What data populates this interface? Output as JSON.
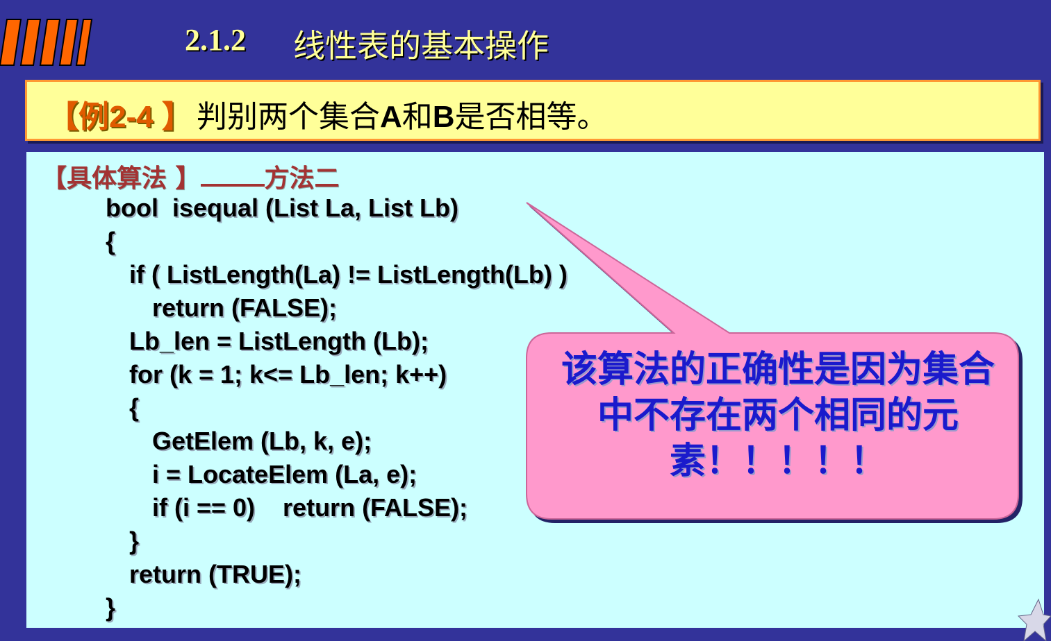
{
  "header": {
    "section_number": "2.1.2",
    "section_title": "线性表的基本操作"
  },
  "example": {
    "tag": "【例2-4 】",
    "text_part1": "判别两个集合",
    "text_A": "A",
    "text_and": "和",
    "text_B": "B",
    "text_part2": "是否相等。"
  },
  "algorithm": {
    "heading_prefix": "【具体算法 】",
    "heading_suffix": "方法二",
    "code_lines": [
      "bool  isequal (List La, List Lb)",
      "{",
      "if ( ListLength(La) != ListLength(Lb) )",
      "return (FALSE);",
      "Lb_len = ListLength (Lb);",
      "for (k = 1; k<= Lb_len; k++)",
      "{",
      "GetElem (Lb, k, e);",
      "i = LocateElem (La, e);",
      "if (i == 0)    return (FALSE);",
      "}",
      "return (TRUE);",
      "}"
    ]
  },
  "callout": {
    "text": "该算法的正确性是因为集合中不存在两个相同的元素！！！！！",
    "fill_color": "#ff99cc"
  },
  "colors": {
    "background": "#33339a",
    "title_color": "#ffff99",
    "example_bg": "#ffff99",
    "example_border": "#ff9933",
    "code_bg": "#ccffff"
  }
}
